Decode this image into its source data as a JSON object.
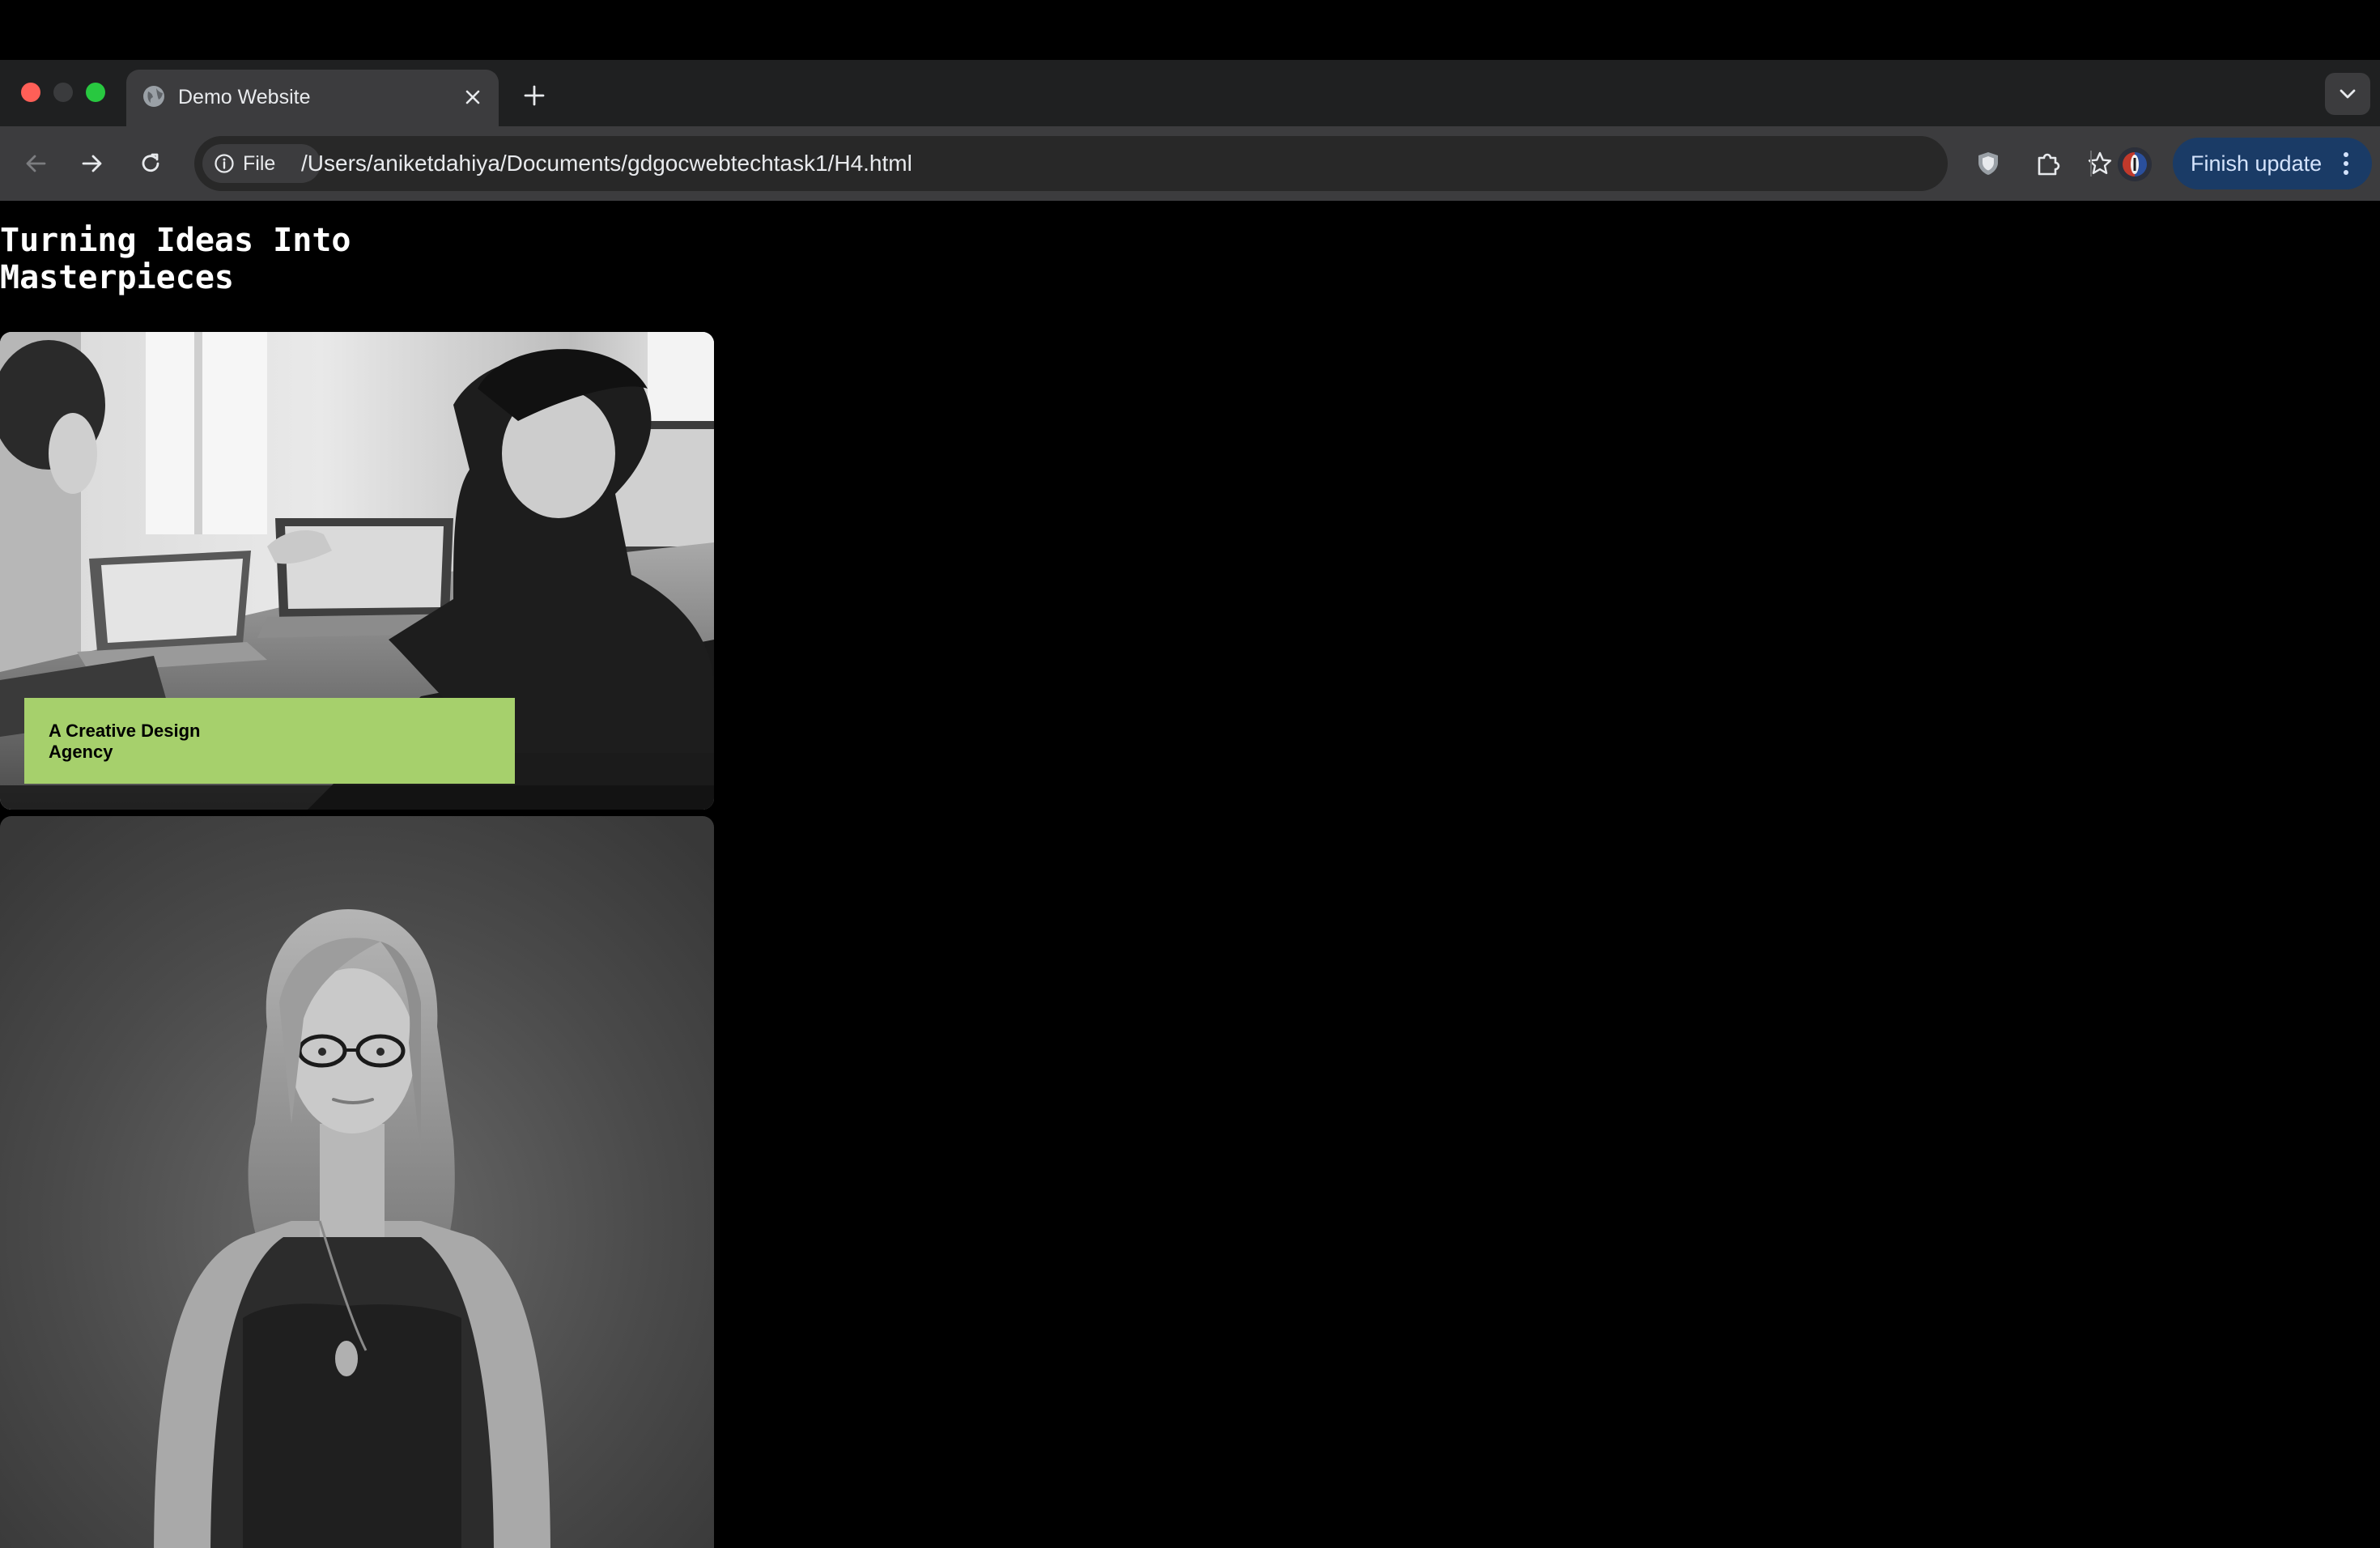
{
  "browser": {
    "tab": {
      "title": "Demo Website"
    },
    "address_bar": {
      "site_chip_label": "File",
      "url": "/Users/aniketdahiya/Documents/gdgocwebtechtask1/H4.html"
    },
    "update_button_label": "Finish update"
  },
  "page": {
    "hero_title": "Turning Ideas Into Masterpieces",
    "cards": [
      {
        "image_description": "office-team-laptops-photo",
        "tag": "A Creative Design Agency"
      },
      {
        "image_description": "woman-portrait-photo"
      }
    ]
  },
  "colors": {
    "page_background": "#000000",
    "tag_background": "#a6d06c",
    "update_button": "#1a3b66"
  }
}
